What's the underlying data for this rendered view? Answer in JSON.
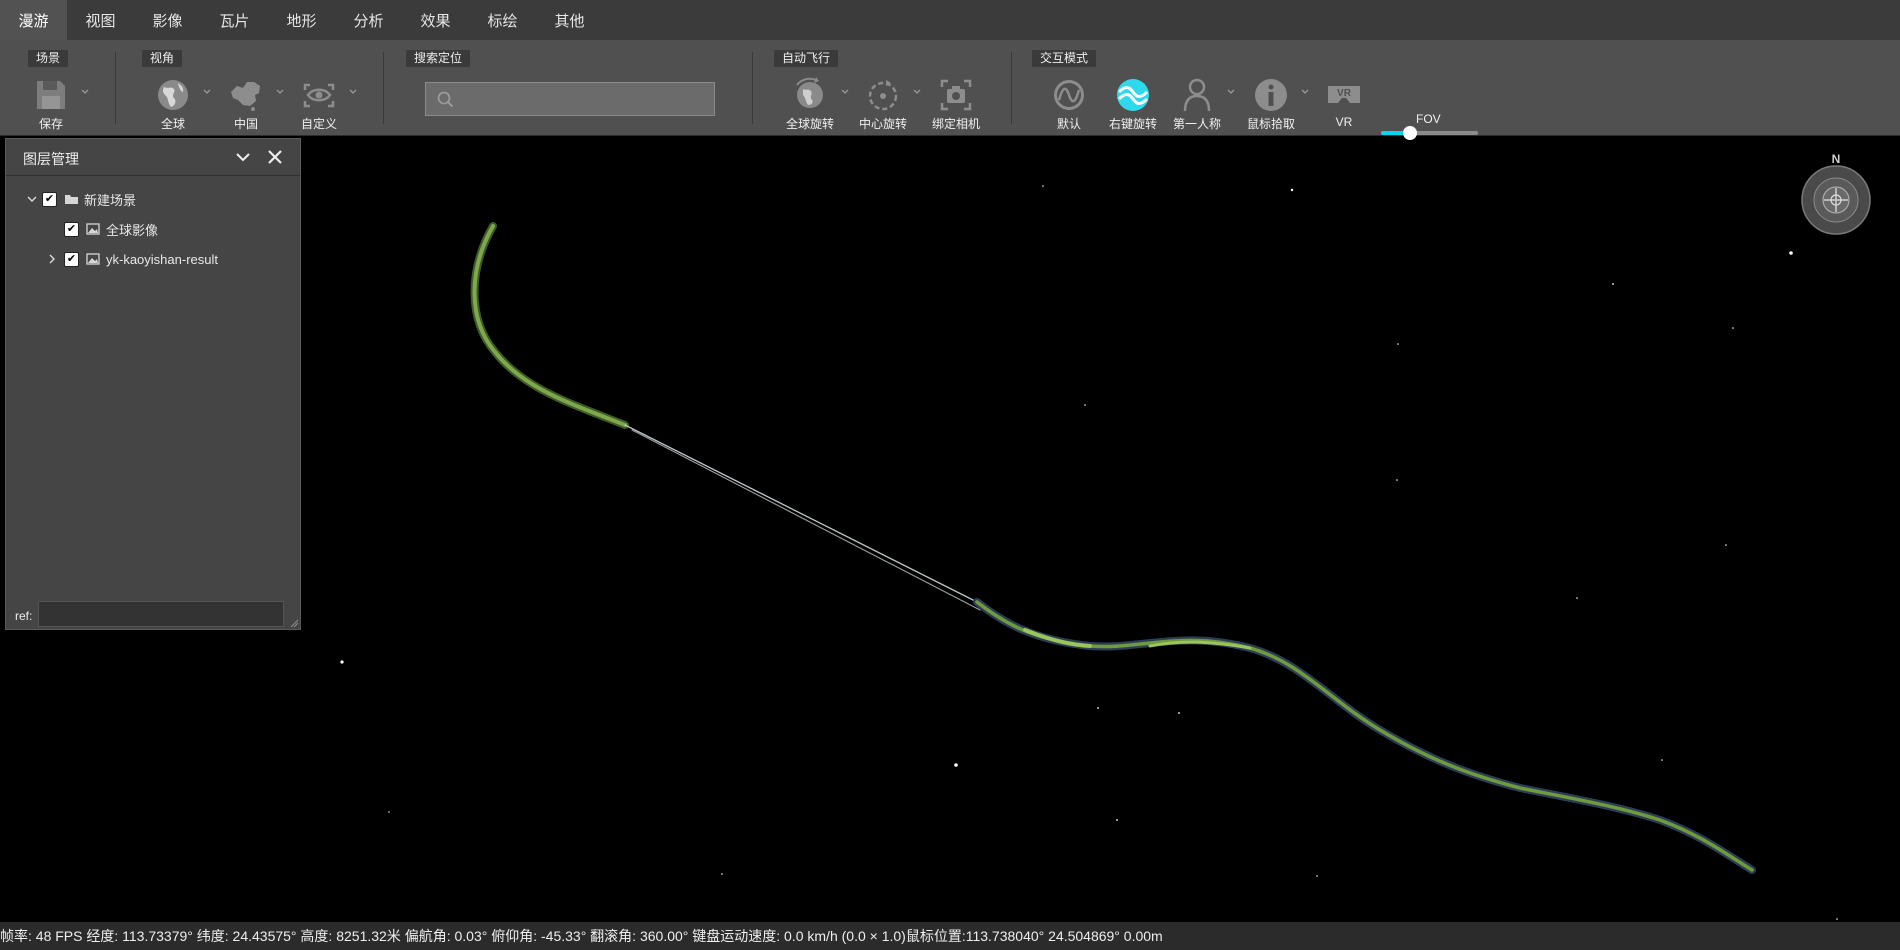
{
  "menu": {
    "tabs": [
      {
        "label": "漫游",
        "active": true
      },
      {
        "label": "视图"
      },
      {
        "label": "影像"
      },
      {
        "label": "瓦片"
      },
      {
        "label": "地形"
      },
      {
        "label": "分析"
      },
      {
        "label": "效果"
      },
      {
        "label": "标绘"
      },
      {
        "label": "其他"
      }
    ]
  },
  "ribbon": {
    "groups": {
      "scene": "场景",
      "view": "视角",
      "search": "搜索定位",
      "autofly": "自动飞行",
      "interact": "交互模式"
    },
    "tools": {
      "save": "保存",
      "globe": "全球",
      "china": "中国",
      "custom": "自定义",
      "globe_rotate": "全球旋转",
      "center_rotate": "中心旋转",
      "bind_camera": "绑定相机",
      "default": "默认",
      "right_rotate": "右键旋转",
      "first_person": "第一人称",
      "mouse_pick": "鼠标拾取",
      "vr": "VR",
      "fov": "FOV"
    },
    "search": {
      "value": "",
      "placeholder": ""
    },
    "fov_fraction": 0.3,
    "accent_color": "#00d8e8"
  },
  "layer_panel": {
    "title": "图层管理",
    "items": [
      {
        "label": "新建场景",
        "checked": true,
        "kind": "folder"
      },
      {
        "label": "全球影像",
        "checked": true,
        "kind": "image"
      },
      {
        "label": "yk-kaoyishan-result",
        "checked": true,
        "kind": "image"
      }
    ],
    "ref_label": "ref:",
    "ref_value": ""
  },
  "compass": {
    "north_label": "N"
  },
  "status": {
    "text": "帧率: 48 FPS 经度: 113.73379° 纬度: 24.43575° 高度: 8251.32米 偏航角: 0.03° 俯仰角: -45.33° 翻滚角: 360.00° 键盘运动速度: 0.0 km/h (0.0 × 1.0)鼠标位置:113.738040° 24.504869° 0.00m"
  },
  "colors": {
    "menubar": "#3b3b3b",
    "ribbon": "#505050",
    "panel": "#454545",
    "route_green": "#6f9a3e",
    "background": "#000000"
  }
}
